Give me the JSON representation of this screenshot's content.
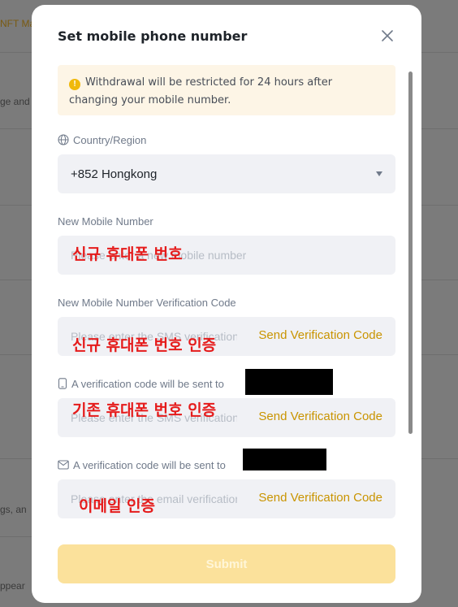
{
  "background": {
    "fragment_top": "NFT Ma",
    "fragment_mid": "ge and",
    "fragment_low": "gs, an",
    "fragment_bottom": "ppear"
  },
  "modal": {
    "title": "Set mobile phone number",
    "close_icon": "close-icon"
  },
  "notice": {
    "icon": "warning-icon",
    "text": "Withdrawal will be restricted for 24 hours after changing your mobile number."
  },
  "country": {
    "label": "Country/Region",
    "icon": "globe-icon",
    "value": "+852 Hongkong"
  },
  "new_mobile": {
    "label": "New Mobile Number",
    "placeholder": "Please enter a new mobile number",
    "overlay": "신규 휴대폰 번호"
  },
  "new_mobile_code": {
    "label": "New Mobile Number Verification Code",
    "placeholder": "Please enter the SMS verification code",
    "send": "Send Verification Code",
    "overlay": "신규 휴대폰 번호 인증"
  },
  "old_mobile_code": {
    "label": "A verification code will be sent to",
    "icon": "mobile-phone-icon",
    "placeholder": "Please enter the SMS verification code",
    "send": "Send Verification Code",
    "overlay": "기존 휴대폰 번호 인증"
  },
  "email_code": {
    "label": "A verification code will be sent to",
    "icon": "envelope-icon",
    "placeholder": "Please enter the email verification code",
    "send": "Send Verification Code",
    "overlay": "이메일 인증"
  },
  "submit": {
    "label": "Submit"
  },
  "colors": {
    "accent": "#c99400",
    "overlay_red": "#e51b1b",
    "submit_bg": "#fbe19b",
    "notice_bg": "#fdf5e6"
  }
}
